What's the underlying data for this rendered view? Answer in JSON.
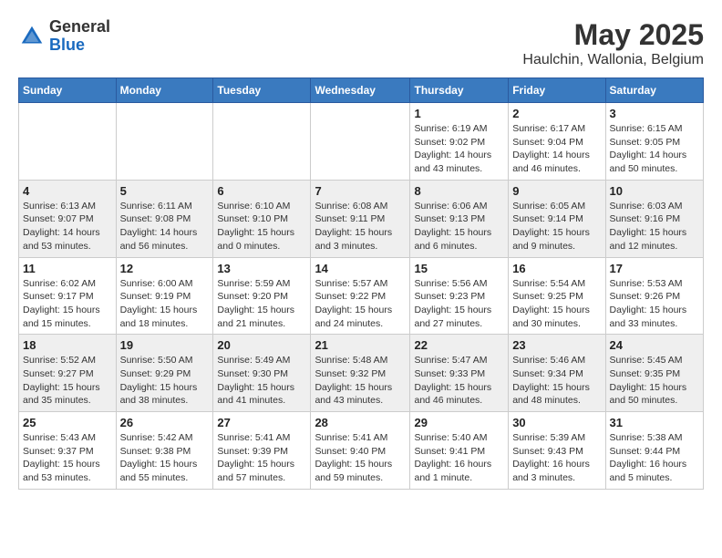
{
  "header": {
    "logo_general": "General",
    "logo_blue": "Blue",
    "title": "May 2025",
    "subtitle": "Haulchin, Wallonia, Belgium"
  },
  "days_of_week": [
    "Sunday",
    "Monday",
    "Tuesday",
    "Wednesday",
    "Thursday",
    "Friday",
    "Saturday"
  ],
  "weeks": [
    [
      {
        "day": "",
        "info": ""
      },
      {
        "day": "",
        "info": ""
      },
      {
        "day": "",
        "info": ""
      },
      {
        "day": "",
        "info": ""
      },
      {
        "day": "1",
        "info": "Sunrise: 6:19 AM\nSunset: 9:02 PM\nDaylight: 14 hours\nand 43 minutes."
      },
      {
        "day": "2",
        "info": "Sunrise: 6:17 AM\nSunset: 9:04 PM\nDaylight: 14 hours\nand 46 minutes."
      },
      {
        "day": "3",
        "info": "Sunrise: 6:15 AM\nSunset: 9:05 PM\nDaylight: 14 hours\nand 50 minutes."
      }
    ],
    [
      {
        "day": "4",
        "info": "Sunrise: 6:13 AM\nSunset: 9:07 PM\nDaylight: 14 hours\nand 53 minutes."
      },
      {
        "day": "5",
        "info": "Sunrise: 6:11 AM\nSunset: 9:08 PM\nDaylight: 14 hours\nand 56 minutes."
      },
      {
        "day": "6",
        "info": "Sunrise: 6:10 AM\nSunset: 9:10 PM\nDaylight: 15 hours\nand 0 minutes."
      },
      {
        "day": "7",
        "info": "Sunrise: 6:08 AM\nSunset: 9:11 PM\nDaylight: 15 hours\nand 3 minutes."
      },
      {
        "day": "8",
        "info": "Sunrise: 6:06 AM\nSunset: 9:13 PM\nDaylight: 15 hours\nand 6 minutes."
      },
      {
        "day": "9",
        "info": "Sunrise: 6:05 AM\nSunset: 9:14 PM\nDaylight: 15 hours\nand 9 minutes."
      },
      {
        "day": "10",
        "info": "Sunrise: 6:03 AM\nSunset: 9:16 PM\nDaylight: 15 hours\nand 12 minutes."
      }
    ],
    [
      {
        "day": "11",
        "info": "Sunrise: 6:02 AM\nSunset: 9:17 PM\nDaylight: 15 hours\nand 15 minutes."
      },
      {
        "day": "12",
        "info": "Sunrise: 6:00 AM\nSunset: 9:19 PM\nDaylight: 15 hours\nand 18 minutes."
      },
      {
        "day": "13",
        "info": "Sunrise: 5:59 AM\nSunset: 9:20 PM\nDaylight: 15 hours\nand 21 minutes."
      },
      {
        "day": "14",
        "info": "Sunrise: 5:57 AM\nSunset: 9:22 PM\nDaylight: 15 hours\nand 24 minutes."
      },
      {
        "day": "15",
        "info": "Sunrise: 5:56 AM\nSunset: 9:23 PM\nDaylight: 15 hours\nand 27 minutes."
      },
      {
        "day": "16",
        "info": "Sunrise: 5:54 AM\nSunset: 9:25 PM\nDaylight: 15 hours\nand 30 minutes."
      },
      {
        "day": "17",
        "info": "Sunrise: 5:53 AM\nSunset: 9:26 PM\nDaylight: 15 hours\nand 33 minutes."
      }
    ],
    [
      {
        "day": "18",
        "info": "Sunrise: 5:52 AM\nSunset: 9:27 PM\nDaylight: 15 hours\nand 35 minutes."
      },
      {
        "day": "19",
        "info": "Sunrise: 5:50 AM\nSunset: 9:29 PM\nDaylight: 15 hours\nand 38 minutes."
      },
      {
        "day": "20",
        "info": "Sunrise: 5:49 AM\nSunset: 9:30 PM\nDaylight: 15 hours\nand 41 minutes."
      },
      {
        "day": "21",
        "info": "Sunrise: 5:48 AM\nSunset: 9:32 PM\nDaylight: 15 hours\nand 43 minutes."
      },
      {
        "day": "22",
        "info": "Sunrise: 5:47 AM\nSunset: 9:33 PM\nDaylight: 15 hours\nand 46 minutes."
      },
      {
        "day": "23",
        "info": "Sunrise: 5:46 AM\nSunset: 9:34 PM\nDaylight: 15 hours\nand 48 minutes."
      },
      {
        "day": "24",
        "info": "Sunrise: 5:45 AM\nSunset: 9:35 PM\nDaylight: 15 hours\nand 50 minutes."
      }
    ],
    [
      {
        "day": "25",
        "info": "Sunrise: 5:43 AM\nSunset: 9:37 PM\nDaylight: 15 hours\nand 53 minutes."
      },
      {
        "day": "26",
        "info": "Sunrise: 5:42 AM\nSunset: 9:38 PM\nDaylight: 15 hours\nand 55 minutes."
      },
      {
        "day": "27",
        "info": "Sunrise: 5:41 AM\nSunset: 9:39 PM\nDaylight: 15 hours\nand 57 minutes."
      },
      {
        "day": "28",
        "info": "Sunrise: 5:41 AM\nSunset: 9:40 PM\nDaylight: 15 hours\nand 59 minutes."
      },
      {
        "day": "29",
        "info": "Sunrise: 5:40 AM\nSunset: 9:41 PM\nDaylight: 16 hours\nand 1 minute."
      },
      {
        "day": "30",
        "info": "Sunrise: 5:39 AM\nSunset: 9:43 PM\nDaylight: 16 hours\nand 3 minutes."
      },
      {
        "day": "31",
        "info": "Sunrise: 5:38 AM\nSunset: 9:44 PM\nDaylight: 16 hours\nand 5 minutes."
      }
    ]
  ]
}
